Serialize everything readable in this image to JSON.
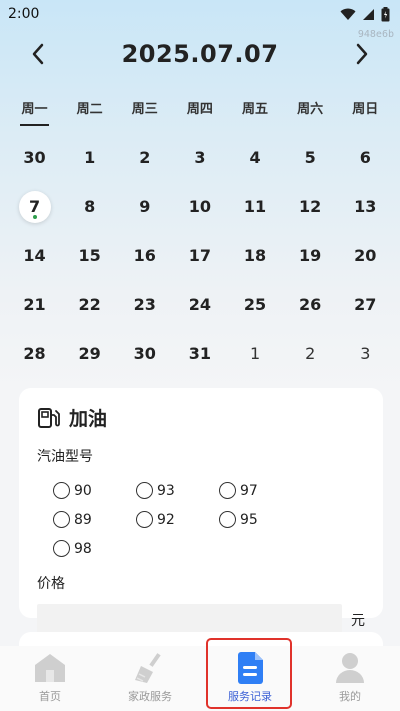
{
  "status_bar": {
    "time": "2:00"
  },
  "watermark": "948e6b",
  "header": {
    "date": "2025.07.07",
    "prev_icon": "chevron-left-icon",
    "next_icon": "chevron-right-icon"
  },
  "weekdays": [
    "周一",
    "周二",
    "周三",
    "周四",
    "周五",
    "周六",
    "周日"
  ],
  "calendar": {
    "rows": [
      [
        "30",
        "1",
        "2",
        "3",
        "4",
        "5",
        "6"
      ],
      [
        "7",
        "8",
        "9",
        "10",
        "11",
        "12",
        "13"
      ],
      [
        "14",
        "15",
        "16",
        "17",
        "18",
        "19",
        "20"
      ],
      [
        "21",
        "22",
        "23",
        "24",
        "25",
        "26",
        "27"
      ],
      [
        "28",
        "29",
        "30",
        "31",
        "1",
        "2",
        "3"
      ]
    ],
    "selected": "7"
  },
  "card": {
    "title": "加油",
    "icon": "fuel-pump-icon",
    "fuel_type_label": "汽油型号",
    "fuel_options": [
      "90",
      "93",
      "97",
      "89",
      "92",
      "95",
      "98"
    ],
    "price_label": "价格",
    "price_value": "",
    "price_unit": "元"
  },
  "tabs": [
    {
      "label": "首页",
      "icon": "home-icon"
    },
    {
      "label": "家政服务",
      "icon": "broom-icon"
    },
    {
      "label": "服务记录",
      "icon": "document-icon"
    },
    {
      "label": "我的",
      "icon": "user-icon"
    }
  ],
  "colors": {
    "accent": "#3e62d6",
    "highlight": "#e0322b",
    "today_dot": "#2e9d4c"
  }
}
